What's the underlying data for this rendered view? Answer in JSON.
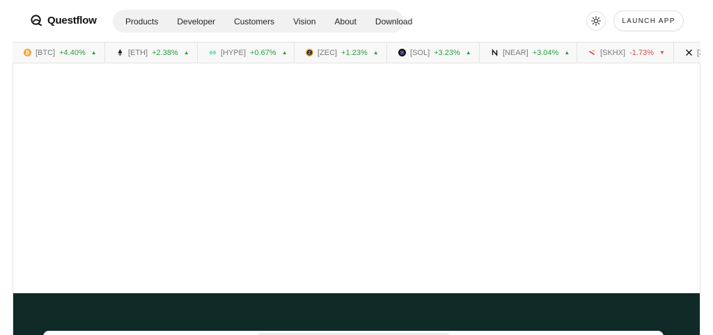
{
  "brand": {
    "name": "Questflow",
    "icon": "questflow-logo-icon"
  },
  "nav": {
    "items": [
      {
        "label": "Products"
      },
      {
        "label": "Developer"
      },
      {
        "label": "Customers"
      },
      {
        "label": "Vision"
      },
      {
        "label": "About"
      },
      {
        "label": "Download"
      }
    ]
  },
  "header": {
    "theme_toggle_icon": "sun-icon",
    "launch_label": "LAUNCH APP"
  },
  "ticker": [
    {
      "symbol": "[BTC]",
      "change": "+4.40%",
      "direction": "up",
      "arrow": "▲",
      "icon_color": "#f2a33a"
    },
    {
      "symbol": "[ETH]",
      "change": "+2.38%",
      "direction": "up",
      "arrow": "▲",
      "icon_color": "#222222"
    },
    {
      "symbol": "[HYPE]",
      "change": "+0.67%",
      "direction": "up",
      "arrow": "▲",
      "icon_color": "#7fe0c7"
    },
    {
      "symbol": "[ZEC]",
      "change": "+1.23%",
      "direction": "up",
      "arrow": "▲",
      "icon_color": "#e8b341"
    },
    {
      "symbol": "[SOL]",
      "change": "+3.23%",
      "direction": "up",
      "arrow": "▲",
      "icon_color": "#111111"
    },
    {
      "symbol": "[NEAR]",
      "change": "+3.04%",
      "direction": "up",
      "arrow": "▲",
      "icon_color": "#111111"
    },
    {
      "symbol": "[SKHX]",
      "change": "-1.73%",
      "direction": "down",
      "arrow": "▼",
      "icon_color": "#e0454a"
    },
    {
      "symbol": "[X",
      "change": "",
      "direction": "up",
      "arrow": "",
      "icon_color": "#111111"
    }
  ],
  "colors": {
    "up": "#2a9d43",
    "down": "#e0454a",
    "footer_bg": "#0f2a27"
  }
}
